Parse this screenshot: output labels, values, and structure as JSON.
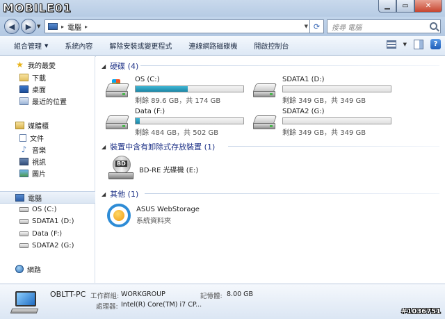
{
  "watermark": {
    "logo": "MOBILE01",
    "id": "#1036751"
  },
  "address": {
    "crumb": "電腦",
    "search_placeholder": "搜尋 電腦"
  },
  "toolbar": {
    "organize": "組合管理",
    "system_props": "系統內容",
    "uninstall": "解除安裝或變更程式",
    "map_drive": "連線網路磁碟機",
    "control_panel": "開啟控制台"
  },
  "nav": {
    "favorites": "我的最愛",
    "downloads": "下載",
    "desktop": "桌面",
    "recent": "最近的位置",
    "libraries": "媒體櫃",
    "documents": "文件",
    "music": "音樂",
    "videos": "視訊",
    "pictures": "圖片",
    "computer": "電腦",
    "drive_os": "OS (C:)",
    "drive_sdata1": "SDATA1 (D:)",
    "drive_data": "Data (F:)",
    "drive_sdata2": "SDATA2 (G:)",
    "network": "網路"
  },
  "groups": {
    "hdd": "硬碟 (4)",
    "removable": "裝置中含有卸除式存放裝置 (1)",
    "other": "其他 (1)"
  },
  "drives": [
    {
      "name": "OS (C:)",
      "free": "剩餘 89.6 GB，共 174 GB",
      "used_fraction": 0.485
    },
    {
      "name": "SDATA1 (D:)",
      "free": "剩餘 349 GB，共 349 GB",
      "used_fraction": 0.0
    },
    {
      "name": "Data (F:)",
      "free": "剩餘 484 GB，共 502 GB",
      "used_fraction": 0.036
    },
    {
      "name": "SDATA2 (G:)",
      "free": "剩餘 349 GB，共 349 GB",
      "used_fraction": 0.0
    }
  ],
  "removable": {
    "name": "BD-RE 光碟機 (E:)",
    "disc_label": "BD"
  },
  "other": {
    "name": "ASUS WebStorage",
    "type": "系統資料夾"
  },
  "details": {
    "pc_name": "OBLTT-PC",
    "workgroup_label": "工作群組:",
    "workgroup_value": "WORKGROUP",
    "memory_label": "記憶體:",
    "memory_value": "8.00 GB",
    "cpu_label": "處理器:",
    "cpu_value": "Intel(R) Core(TM) i7 CP..."
  },
  "colors": {
    "bar_fill": "#1c86a6",
    "group_header": "#1e3287"
  }
}
